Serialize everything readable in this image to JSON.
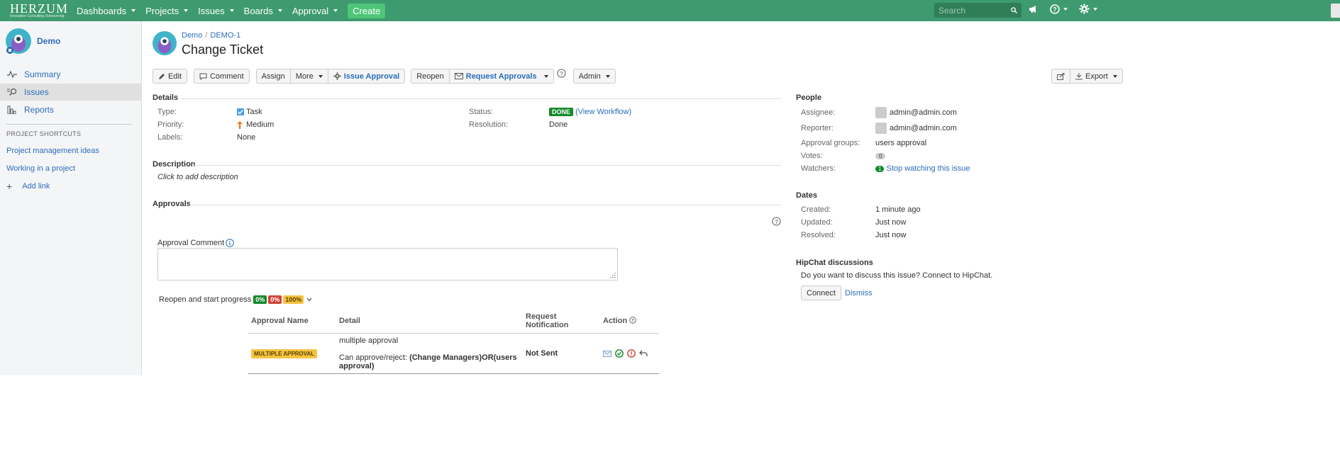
{
  "nav": {
    "logo": "HERZUM",
    "logo_tag": "Innovation Consulting Outsourcing",
    "items": [
      "Dashboards",
      "Projects",
      "Issues",
      "Boards",
      "Approval"
    ],
    "create": "Create",
    "search_placeholder": "Search"
  },
  "sidebar": {
    "project_name": "Demo",
    "items": [
      "Summary",
      "Issues",
      "Reports"
    ],
    "shortcuts_head": "PROJECT SHORTCUTS",
    "shortcuts": [
      "Project management ideas",
      "Working in a project"
    ],
    "add_link": "Add link"
  },
  "issue": {
    "crumb_project": "Demo",
    "crumb_key": "DEMO-1",
    "title": "Change Ticket"
  },
  "toolbar": {
    "edit": "Edit",
    "comment": "Comment",
    "assign": "Assign",
    "more": "More",
    "issue_approval": "Issue Approval",
    "reopen": "Reopen",
    "request_approvals": "Request Approvals",
    "admin": "Admin",
    "export": "Export"
  },
  "details": {
    "head": "Details",
    "type_label": "Type:",
    "type_value": "Task",
    "priority_label": "Priority:",
    "priority_value": "Medium",
    "labels_label": "Labels:",
    "labels_value": "None",
    "status_label": "Status:",
    "status_value": "DONE",
    "view_workflow": "(View Workflow)",
    "resolution_label": "Resolution:",
    "resolution_value": "Done"
  },
  "description": {
    "head": "Description",
    "placeholder": "Click to add description"
  },
  "approvals": {
    "head": "Approvals",
    "comment_label": "Approval Comment",
    "transition": "Reopen and start progress",
    "pct_approved": "0%",
    "pct_rejected": "0%",
    "pct_pending": "100%",
    "columns": [
      "Approval Name",
      "Detail",
      "Request Notification",
      "Action"
    ],
    "row": {
      "name": "MULTIPLE APPROVAL",
      "detail_title": "multiple approval",
      "detail_prefix": "Can approve/reject: ",
      "detail_groups": "(Change Managers)OR(users approval)",
      "notification": "Not Sent"
    }
  },
  "people": {
    "head": "People",
    "assignee_label": "Assignee:",
    "assignee": "admin@admin.com",
    "reporter_label": "Reporter:",
    "reporter": "admin@admin.com",
    "groups_label": "Approval groups:",
    "groups": "users approval",
    "votes_label": "Votes:",
    "votes": "0",
    "watchers_label": "Watchers:",
    "watchers": "1",
    "watch_link": "Stop watching this issue"
  },
  "dates": {
    "head": "Dates",
    "created_label": "Created:",
    "created": "1 minute ago",
    "updated_label": "Updated:",
    "updated": "Just now",
    "resolved_label": "Resolved:",
    "resolved": "Just now"
  },
  "hipchat": {
    "head": "HipChat discussions",
    "text": "Do you want to discuss this issue? Connect to HipChat.",
    "connect": "Connect",
    "dismiss": "Dismiss"
  },
  "colors": {
    "nav_bg": "#3e9a6f",
    "link": "#2a6ebb",
    "done": "#14892c",
    "pending": "#f6c342",
    "rejected": "#d04437"
  }
}
